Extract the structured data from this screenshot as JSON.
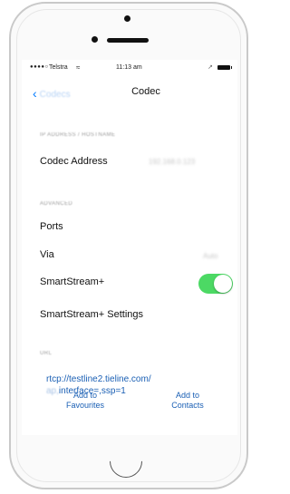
{
  "status_bar": {
    "signal": "●●●●○",
    "carrier": "Telstra",
    "wifi": "≈",
    "time": "11:13 am",
    "location": "↗"
  },
  "navbar": {
    "back_label": "Codecs",
    "title": "Codec"
  },
  "sections": {
    "address_header": "IP ADDRESS / HOSTNAME",
    "advanced_header": "ADVANCED",
    "url_header": "URL"
  },
  "rows": {
    "codec_address_label": "Codec Address",
    "codec_address_value": "192.168.0.123",
    "ports_label": "Ports",
    "via_label": "Via",
    "via_value": "Auto",
    "smartstream_label": "SmartStream+",
    "smartstream_enabled": true,
    "smartstream_settings_label": "SmartStream+ Settings"
  },
  "url": {
    "line1": "rtcp://testline2.tieline.com/",
    "line2_prefix": "ap,",
    "line2_main": "interface=,ssp=1"
  },
  "actions": {
    "add_favourites": [
      "Add to",
      "Favourites"
    ],
    "add_contacts": [
      "Add to",
      "Contacts"
    ]
  },
  "colors": {
    "accent": "#1a5fb4",
    "toggle_on": "#4cd964"
  }
}
